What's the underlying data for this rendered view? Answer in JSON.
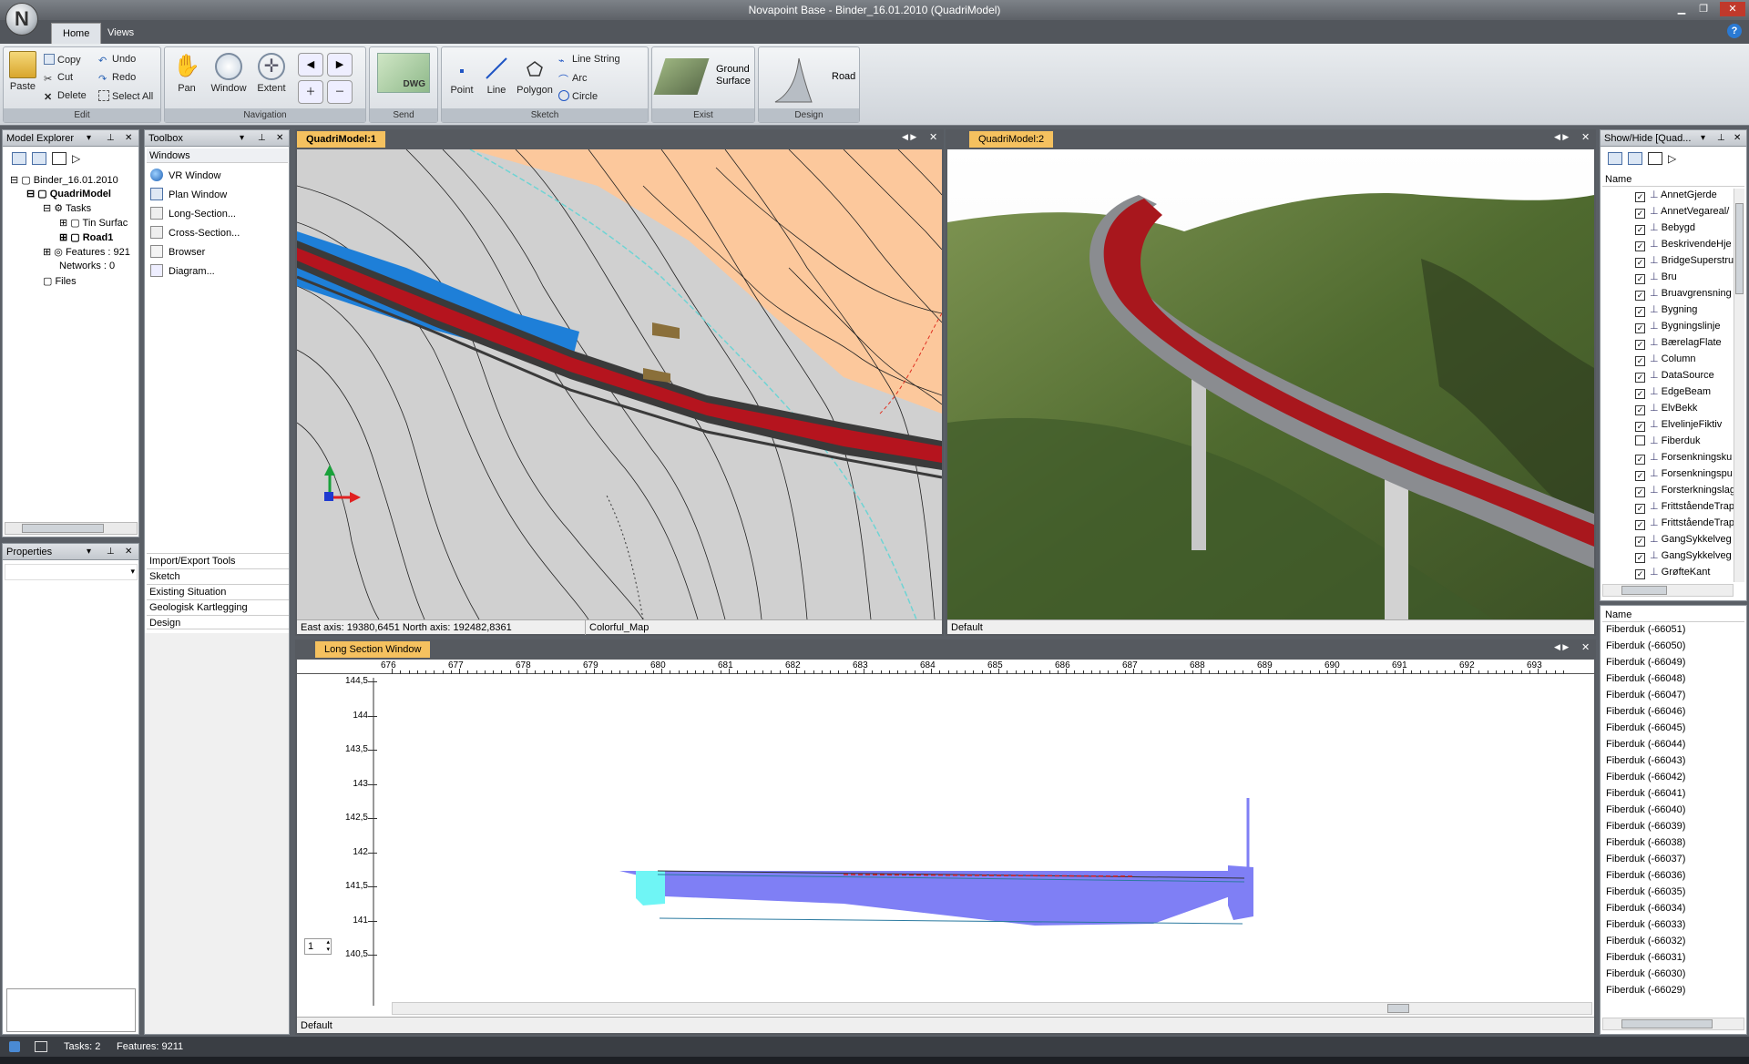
{
  "window": {
    "title": "Novapoint Base - Binder_16.01.2010 (QuadriModel)",
    "logo_letter": "N"
  },
  "tabs": [
    "Home",
    "Views"
  ],
  "ribbon": {
    "edit": {
      "label": "Edit",
      "paste": "Paste",
      "copy": "Copy",
      "cut": "Cut",
      "delete": "Delete",
      "undo": "Undo",
      "redo": "Redo",
      "select_all": "Select All"
    },
    "navigation": {
      "label": "Navigation",
      "pan": "Pan",
      "window": "Window",
      "extent": "Extent"
    },
    "send": {
      "label": "Send",
      "dwg": "DWG"
    },
    "sketch": {
      "label": "Sketch",
      "point": "Point",
      "line": "Line",
      "polygon": "Polygon",
      "line_string": "Line String",
      "arc": "Arc",
      "circle": "Circle"
    },
    "exist": {
      "label": "Exist",
      "ground_surface_1": "Ground",
      "ground_surface_2": "Surface"
    },
    "design": {
      "label": "Design",
      "road": "Road"
    }
  },
  "model_explorer": {
    "title": "Model Explorer",
    "items": [
      "Binder_16.01.2010",
      "QuadriModel",
      "Tasks",
      "Tin Surfac",
      "Road1",
      "Features : 921",
      "Networks : 0",
      "Files"
    ]
  },
  "properties": {
    "title": "Properties"
  },
  "toolbox": {
    "title": "Toolbox",
    "windows_header": "Windows",
    "items": [
      "VR Window",
      "Plan Window",
      "Long-Section...",
      "Cross-Section...",
      "Browser",
      "Diagram..."
    ],
    "sections": [
      "Import/Export Tools",
      "Sketch",
      "Existing Situation",
      "Geologisk Kartlegging",
      "Design"
    ]
  },
  "plan_view": {
    "tab": "QuadriModel:1",
    "status_coords": "East axis: 19380,6451 North axis: 192482,8361",
    "status_style": "Colorful_Map"
  },
  "view3d": {
    "tab": "QuadriModel:2",
    "status": "Default"
  },
  "long_section": {
    "tab": "Long Section Window",
    "status": "Default",
    "x_ticks": [
      "676",
      "677",
      "678",
      "679",
      "680",
      "681",
      "682",
      "683",
      "684",
      "685",
      "686",
      "687",
      "688",
      "689",
      "690",
      "691",
      "692",
      "693"
    ],
    "y_ticks": [
      "144,5",
      "144",
      "143,5",
      "143",
      "142,5",
      "142",
      "141,5",
      "141",
      "140,5"
    ],
    "spin_value": "1"
  },
  "show_hide": {
    "title": "Show/Hide [Quad...",
    "column": "Name",
    "layers": [
      "AnnetGjerde",
      "AnnetVegareal/",
      "Bebygd",
      "BeskrivendeHje",
      "BridgeSuperstru",
      "Bru",
      "Bruavgrensning",
      "Bygning",
      "Bygningslinje",
      "BærelagFlate",
      "Column",
      "DataSource",
      "EdgeBeam",
      "ElvBekk",
      "ElvelinjeFiktiv",
      "Fiberduk",
      "Forsenkningsku",
      "Forsenkningspu",
      "Forsterkningslag",
      "FrittståendeTrap",
      "FrittståendeTrap",
      "GangSykkelveg",
      "GangSykkelveg",
      "GrøfteKant"
    ],
    "checked": [
      true,
      true,
      true,
      true,
      true,
      true,
      true,
      true,
      true,
      true,
      true,
      true,
      true,
      true,
      true,
      false,
      true,
      true,
      true,
      true,
      true,
      true,
      true,
      true
    ]
  },
  "feature_list": {
    "column": "Name",
    "items": [
      "Fiberduk (-66051)",
      "Fiberduk (-66050)",
      "Fiberduk (-66049)",
      "Fiberduk (-66048)",
      "Fiberduk (-66047)",
      "Fiberduk (-66046)",
      "Fiberduk (-66045)",
      "Fiberduk (-66044)",
      "Fiberduk (-66043)",
      "Fiberduk (-66042)",
      "Fiberduk (-66041)",
      "Fiberduk (-66040)",
      "Fiberduk (-66039)",
      "Fiberduk (-66038)",
      "Fiberduk (-66037)",
      "Fiberduk (-66036)",
      "Fiberduk (-66035)",
      "Fiberduk (-66034)",
      "Fiberduk (-66033)",
      "Fiberduk (-66032)",
      "Fiberduk (-66031)",
      "Fiberduk (-66030)",
      "Fiberduk (-66029)"
    ]
  },
  "statusbar": {
    "tasks": "Tasks: 2",
    "features": "Features: 9211"
  },
  "colors": {
    "road_red": "#b5141e",
    "water_blue": "#1e7fd8",
    "terrain_orange": "#fcc89c",
    "section_fill": "#7f7ff5",
    "section_cyan": "#6ff5f5"
  }
}
